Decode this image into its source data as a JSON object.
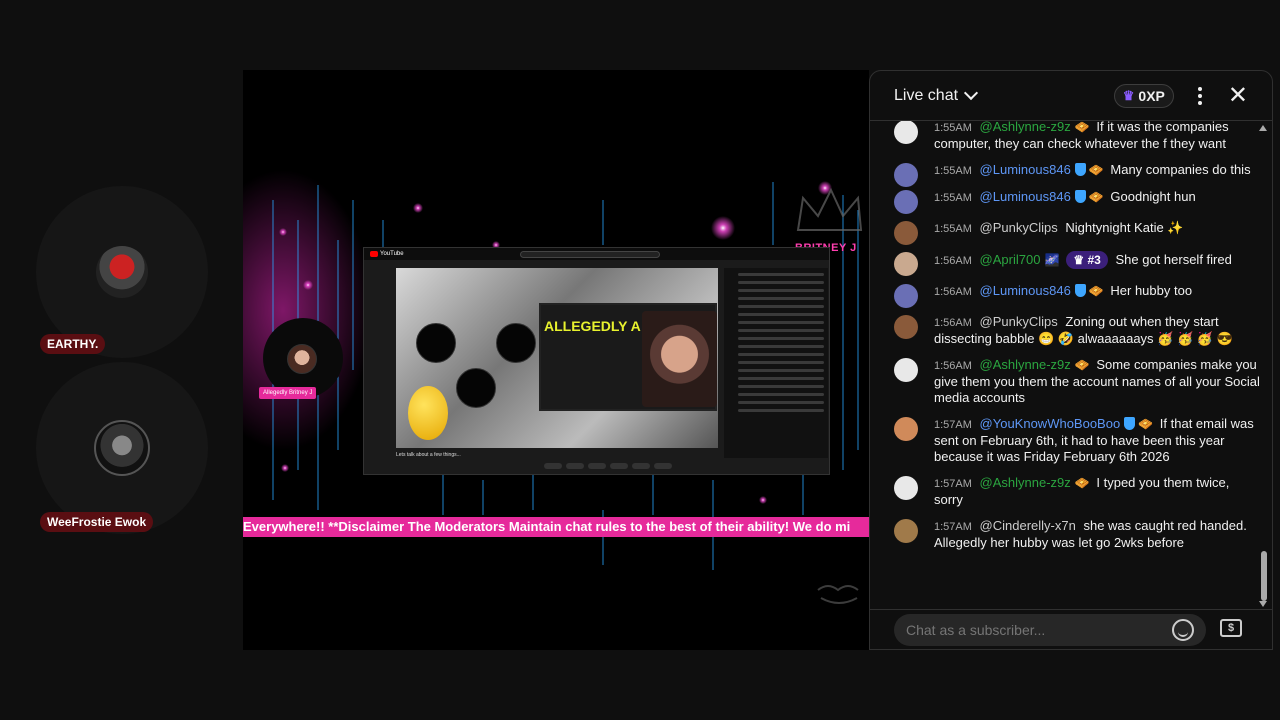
{
  "participants": [
    {
      "name": "EARTHY."
    },
    {
      "name": "WeeFrostie Ewok"
    }
  ],
  "video": {
    "ticker": "Everywhere!! **Disclaimer The Moderators Maintain chat rules to the best of their ability! We do mi",
    "inner_headline": "ALLEGEDLY A GRIFTER.",
    "inner_caption": "Lets talk about a few things...",
    "guest_badge": "Allegedly Britney J",
    "brand_text": "BRITNEY J"
  },
  "chat": {
    "title": "Live chat",
    "xp": "0XP",
    "input_placeholder": "Chat as a subscriber...",
    "money_icon": "$",
    "messages": [
      {
        "time": "1:55AM",
        "user": "@Ashlynne-z9z",
        "color": "#2ba640",
        "text": "If it was the companies computer, they can check whatever the f they want"
      },
      {
        "time": "1:55AM",
        "user": "@Luminous846",
        "color": "#5e97f6",
        "text": "Many companies do this"
      },
      {
        "time": "1:55AM",
        "user": "@Luminous846",
        "color": "#5e97f6",
        "text": "Goodnight hun"
      },
      {
        "time": "1:55AM",
        "user": "@PunkyClips",
        "color": "#cccccc",
        "text": "Nightynight Katie ✨"
      },
      {
        "time": "1:56AM",
        "user": "@April700",
        "color": "#2ba640",
        "rank": "#3",
        "text": "She got herself fired"
      },
      {
        "time": "1:56AM",
        "user": "@Luminous846",
        "color": "#5e97f6",
        "text": "Her hubby too"
      },
      {
        "time": "1:56AM",
        "user": "@PunkyClips",
        "color": "#cccccc",
        "text": "Zoning out when they start dissecting babble 😁 🤣 alwaaaaaays 🥳 🥳 🥳 😎"
      },
      {
        "time": "1:56AM",
        "user": "@Ashlynne-z9z",
        "color": "#2ba640",
        "text": "Some companies make you give them you them the account names of all your Social media accounts"
      },
      {
        "time": "1:57AM",
        "user": "@YouKnowWhoBooBoo",
        "color": "#5e97f6",
        "text": "If that email was sent on February 6th, it had to have been this year because it was Friday February 6th 2026"
      },
      {
        "time": "1:57AM",
        "user": "@Ashlynne-z9z",
        "color": "#2ba640",
        "text": "I typed you them twice, sorry"
      },
      {
        "time": "1:57AM",
        "user": "@Cinderelly-x7n",
        "color": "#cccccc",
        "text": "she was caught red handed. Allegedly her hubby was let go 2wks before"
      }
    ]
  }
}
